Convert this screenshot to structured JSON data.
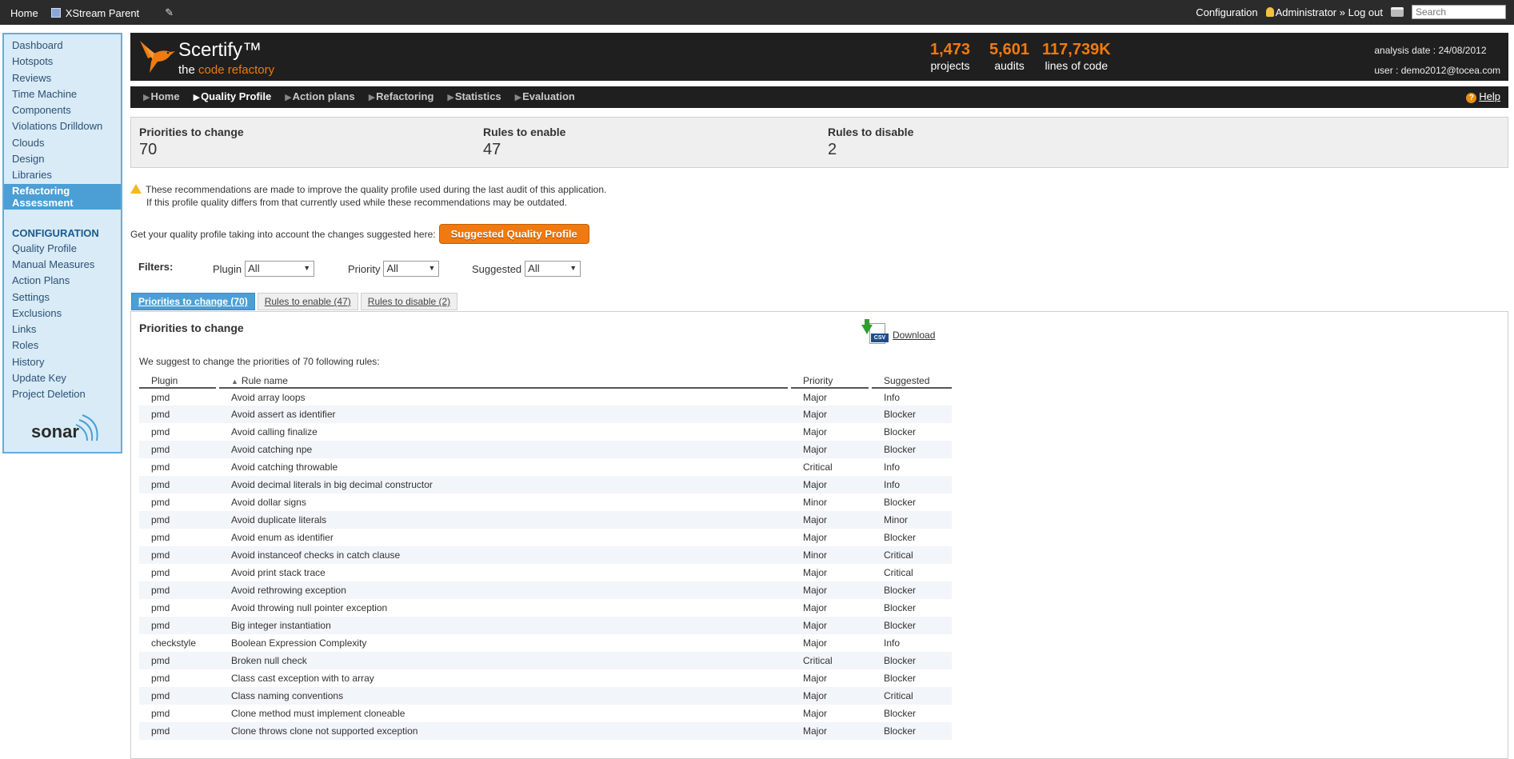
{
  "topbar": {
    "home": "Home",
    "project": "XStream Parent",
    "configuration": "Configuration",
    "user": "Administrator",
    "sep": "»",
    "logout": "Log out",
    "search_placeholder": "Search"
  },
  "sidebar": {
    "items": [
      {
        "label": "Dashboard"
      },
      {
        "label": "Hotspots"
      },
      {
        "label": "Reviews"
      },
      {
        "label": "Time Machine"
      },
      {
        "label": "Components"
      },
      {
        "label": "Violations Drilldown"
      },
      {
        "label": "Clouds"
      },
      {
        "label": "Design"
      },
      {
        "label": "Libraries"
      }
    ],
    "active_line1": "Refactoring",
    "active_line2": "Assessment",
    "config_title": "CONFIGURATION",
    "config_items": [
      {
        "label": "Quality Profile"
      },
      {
        "label": "Manual Measures"
      },
      {
        "label": "Action Plans"
      },
      {
        "label": "Settings"
      },
      {
        "label": "Exclusions"
      },
      {
        "label": "Links"
      },
      {
        "label": "Roles"
      },
      {
        "label": "History"
      },
      {
        "label": "Update Key"
      },
      {
        "label": "Project Deletion"
      }
    ],
    "logo_text": "sonar"
  },
  "header": {
    "brand": "Scertify™",
    "tagline_prefix": "the ",
    "tagline_highlight": "code refactory",
    "stats": [
      {
        "value": "1,473",
        "label": "projects"
      },
      {
        "value": "5,601",
        "label": "audits"
      },
      {
        "value": "117,739K",
        "label": "lines of code"
      }
    ],
    "analysis_label": "analysis date :",
    "analysis_date": "24/08/2012",
    "user_label": "user :",
    "user_email": "demo2012@tocea.com"
  },
  "nav": {
    "tabs": [
      "Home",
      "Quality Profile",
      "Action plans",
      "Refactoring",
      "Statistics",
      "Evaluation"
    ],
    "active": "Quality Profile",
    "help": "Help"
  },
  "summary": [
    {
      "title": "Priorities to change",
      "value": "70"
    },
    {
      "title": "Rules to enable",
      "value": "47"
    },
    {
      "title": "Rules to disable",
      "value": "2"
    }
  ],
  "notice": {
    "line1": "These recommendations are made to improve the quality profile used during the last audit of this application.",
    "line2": "If this profile quality differs from that currently used while these recommendations may be outdated."
  },
  "quality_profile": {
    "text": "Get your quality profile taking into account the changes suggested here:",
    "button": "Suggested Quality Profile"
  },
  "filters": {
    "label": "Filters:",
    "plugin_label": "Plugin",
    "plugin_value": "All",
    "priority_label": "Priority",
    "priority_value": "All",
    "suggested_label": "Suggested",
    "suggested_value": "All"
  },
  "subtabs": [
    "Priorities to change (70)",
    "Rules to enable (47)",
    "Rules to disable (2)"
  ],
  "panel": {
    "title": "Priorities to change",
    "download": "Download",
    "csv": "CSV",
    "intro": "We suggest to change the priorities of 70 following rules:",
    "columns": [
      "Plugin",
      "Rule name",
      "Priority",
      "Suggested"
    ],
    "rows": [
      [
        "pmd",
        "Avoid array loops",
        "Major",
        "Info"
      ],
      [
        "pmd",
        "Avoid assert as identifier",
        "Major",
        "Blocker"
      ],
      [
        "pmd",
        "Avoid calling finalize",
        "Major",
        "Blocker"
      ],
      [
        "pmd",
        "Avoid catching npe",
        "Major",
        "Blocker"
      ],
      [
        "pmd",
        "Avoid catching throwable",
        "Critical",
        "Info"
      ],
      [
        "pmd",
        "Avoid decimal literals in big decimal constructor",
        "Major",
        "Info"
      ],
      [
        "pmd",
        "Avoid dollar signs",
        "Minor",
        "Blocker"
      ],
      [
        "pmd",
        "Avoid duplicate literals",
        "Major",
        "Minor"
      ],
      [
        "pmd",
        "Avoid enum as identifier",
        "Major",
        "Blocker"
      ],
      [
        "pmd",
        "Avoid instanceof checks in catch clause",
        "Minor",
        "Critical"
      ],
      [
        "pmd",
        "Avoid print stack trace",
        "Major",
        "Critical"
      ],
      [
        "pmd",
        "Avoid rethrowing exception",
        "Major",
        "Blocker"
      ],
      [
        "pmd",
        "Avoid throwing null pointer exception",
        "Major",
        "Blocker"
      ],
      [
        "pmd",
        "Big integer instantiation",
        "Major",
        "Blocker"
      ],
      [
        "checkstyle",
        "Boolean Expression Complexity",
        "Major",
        "Info"
      ],
      [
        "pmd",
        "Broken null check",
        "Critical",
        "Blocker"
      ],
      [
        "pmd",
        "Class cast exception with to array",
        "Major",
        "Blocker"
      ],
      [
        "pmd",
        "Class naming conventions",
        "Major",
        "Critical"
      ],
      [
        "pmd",
        "Clone method must implement cloneable",
        "Major",
        "Blocker"
      ],
      [
        "pmd",
        "Clone throws clone not supported exception",
        "Major",
        "Blocker"
      ]
    ]
  }
}
